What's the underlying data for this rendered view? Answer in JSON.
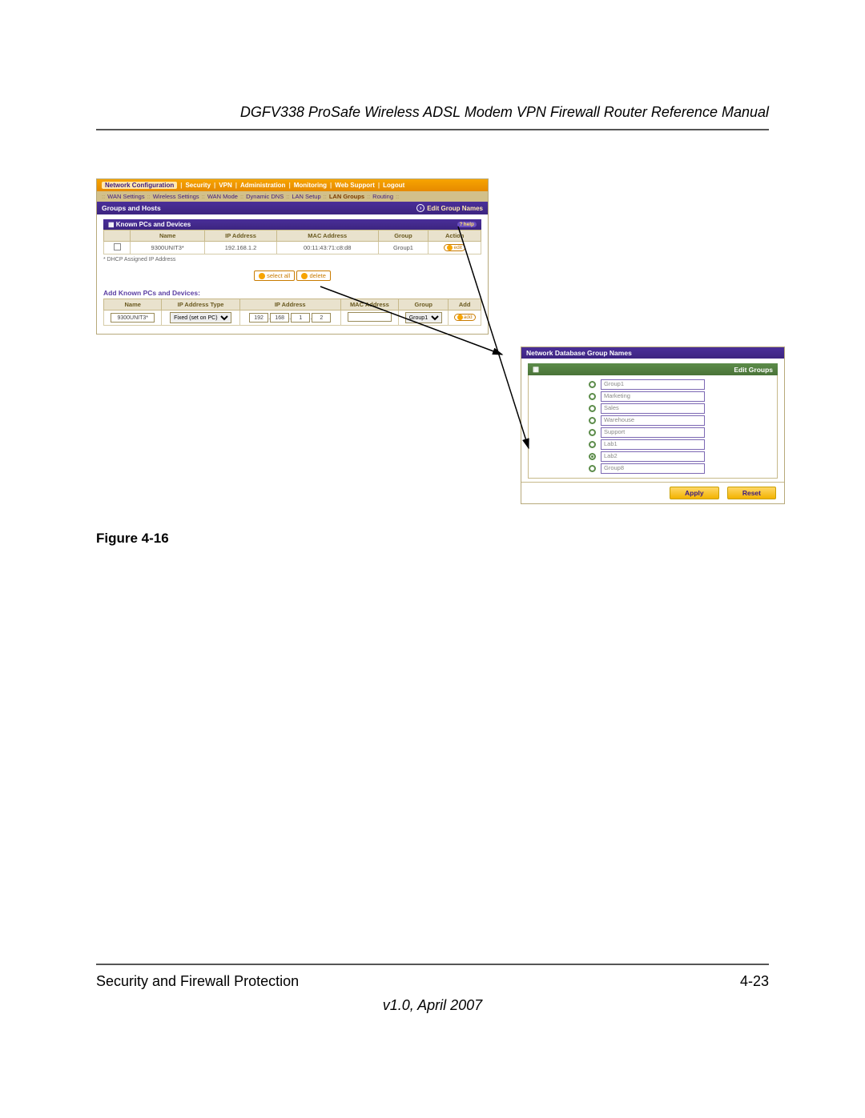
{
  "doc": {
    "header": "DGFV338 ProSafe Wireless ADSL Modem VPN Firewall Router Reference Manual",
    "figure_caption": "Figure 4-16",
    "footer_left": "Security and Firewall Protection",
    "footer_right": "4-23",
    "version": "v1.0, April 2007"
  },
  "ss1": {
    "nav_top": [
      "Network Configuration",
      "|",
      "Security",
      "|",
      "VPN",
      "|",
      "Administration",
      "|",
      "Monitoring",
      "|",
      "Web Support",
      "|",
      "Logout"
    ],
    "nav_top_active_index": 0,
    "nav_sub": [
      "::",
      "WAN Settings",
      "::",
      "Wireless Settings",
      "::",
      "WAN Mode",
      "::",
      "Dynamic DNS",
      "::",
      "LAN Setup",
      "::",
      "LAN Groups",
      "::",
      "Routing",
      "::"
    ],
    "nav_sub_active_index": 11,
    "title": "Groups and Hosts",
    "title_link": "Edit Group Names",
    "panel1_title": "Known PCs and Devices",
    "help_label": "help",
    "table1": {
      "headers": [
        "",
        "Name",
        "IP Address",
        "MAC Address",
        "Group",
        "Action"
      ],
      "row": {
        "name": "9300UNIT3*",
        "ip": "192.168.1.2",
        "mac": "00:11:43:71:c8:d8",
        "group": "Group1",
        "action": "edit"
      }
    },
    "note": "* DHCP Assigned IP Address",
    "btn_select_all": "select all",
    "btn_delete": "delete",
    "section2_title": "Add Known PCs and Devices:",
    "table2": {
      "headers": [
        "Name",
        "IP Address Type",
        "IP Address",
        "MAC Address",
        "Group",
        "Add"
      ],
      "row": {
        "name": "9300UNIT3*",
        "type": "Fixed (set on PC)",
        "ip": [
          "192",
          "168",
          "1",
          "2"
        ],
        "mac": "",
        "group": "Group1",
        "add": "add"
      }
    }
  },
  "ss2": {
    "title": "Network Database Group Names",
    "panel_title": "Edit Groups",
    "groups": [
      {
        "name": "Group1",
        "selected": false
      },
      {
        "name": "Marketing",
        "selected": false
      },
      {
        "name": "Sales",
        "selected": false
      },
      {
        "name": "Warehouse",
        "selected": false
      },
      {
        "name": "Support",
        "selected": false
      },
      {
        "name": "Lab1",
        "selected": false
      },
      {
        "name": "Lab2",
        "selected": true
      },
      {
        "name": "Group8",
        "selected": false
      }
    ],
    "apply": "Apply",
    "reset": "Reset"
  }
}
